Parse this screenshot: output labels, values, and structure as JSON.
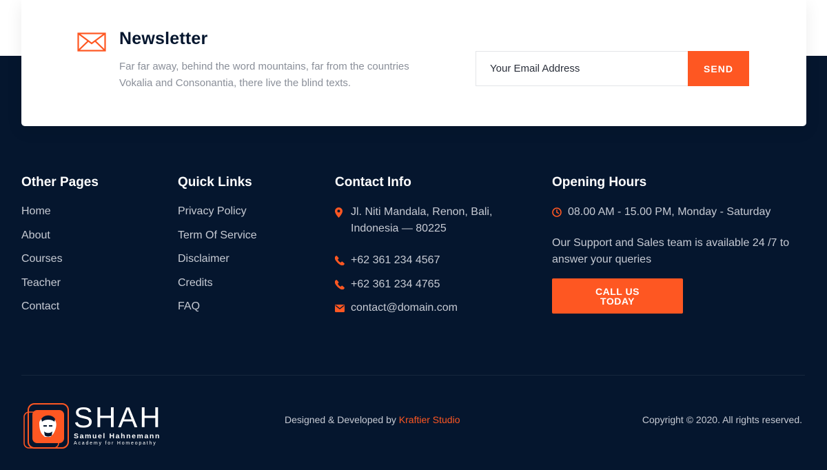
{
  "newsletter": {
    "title": "Newsletter",
    "description": "Far far away, behind the word mountains, far from the countries Vokalia and Consonantia, there live the blind texts.",
    "email_placeholder": "Your Email Address",
    "send_label": "SEND",
    "icon": "envelope-icon"
  },
  "columns": {
    "other_pages": {
      "title": "Other Pages",
      "items": [
        "Home",
        "About",
        "Courses",
        "Teacher",
        "Contact"
      ]
    },
    "quick_links": {
      "title": "Quick Links",
      "items": [
        "Privacy Policy",
        "Term Of Service",
        "Disclaimer",
        "Credits",
        "FAQ"
      ]
    },
    "contact_info": {
      "title": "Contact Info",
      "address": "Jl. Niti Mandala, Renon, Bali, Indonesia — 80225",
      "phone1": "+62 361 234 4567",
      "phone2": "+62 361 234 4765",
      "email": "contact@domain.com"
    },
    "opening_hours": {
      "title": "Opening Hours",
      "hours": "08.00 AM - 15.00 PM, Monday - Saturday",
      "note": "Our Support and Sales team is available 24 /7 to answer your queries",
      "call_label": "CALL US TODAY"
    }
  },
  "bottom": {
    "logo_main": "SHAH",
    "logo_sub1": "Samuel Hahnemann",
    "logo_sub2": "Academy for Homeopathy",
    "credit_prefix": "Designed & Developed by",
    "credit_studio": "Kraftier Studio",
    "copyright": "Copyright © 2020. All rights reserved."
  },
  "colors": {
    "accent": "#fe5722",
    "footer_bg": "#05162e",
    "text_muted": "#c6cad3"
  }
}
